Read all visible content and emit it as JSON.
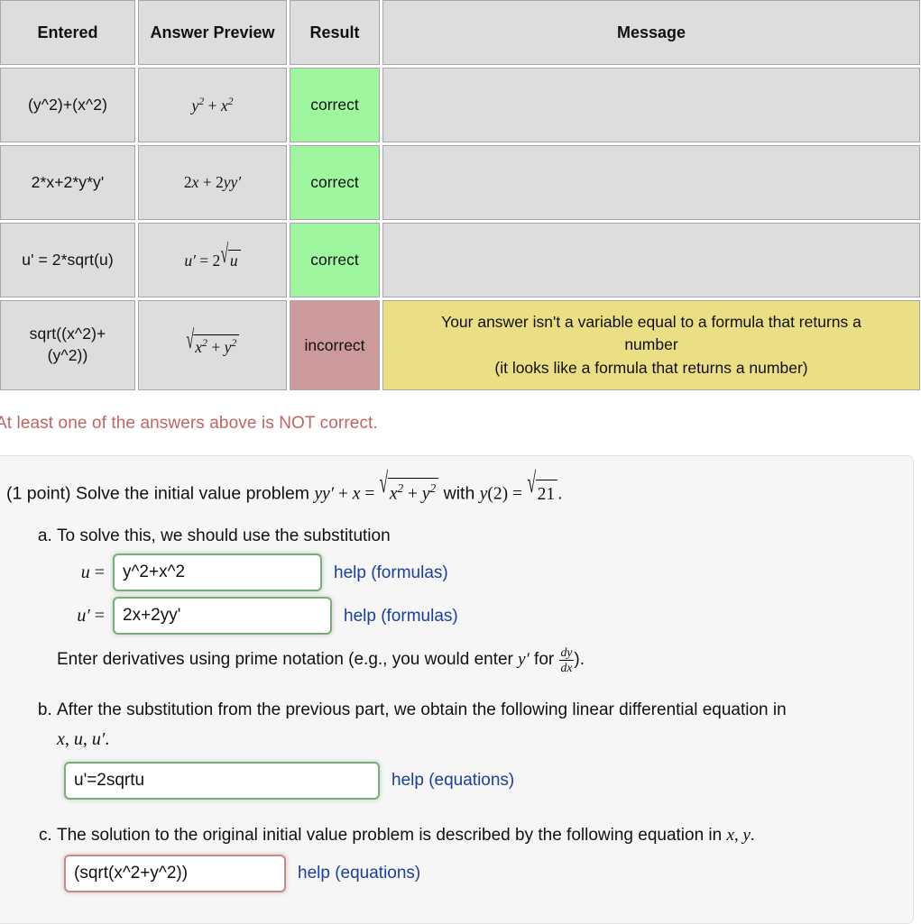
{
  "results_table": {
    "headers": [
      "Entered",
      "Answer Preview",
      "Result",
      "Message"
    ],
    "rows": [
      {
        "entered": "(y^2)+(x^2)",
        "preview_tex": "y^2 + x^2",
        "result": "correct",
        "message": ""
      },
      {
        "entered": "2*x+2*y*y'",
        "preview_tex": "2x + 2yy'",
        "result": "correct",
        "message": ""
      },
      {
        "entered": "u' = 2*sqrt(u)",
        "preview_tex": "u' = 2\\sqrt{u}",
        "result": "correct",
        "message": ""
      },
      {
        "entered": "sqrt((x^2)+(y^2))",
        "preview_tex": "\\sqrt{x^2 + y^2}",
        "result": "incorrect",
        "message_line1": "Your answer isn't a variable equal to a formula that returns a",
        "message_line2": "number",
        "message_line3": "(it looks like a formula that returns a number)"
      }
    ]
  },
  "alert": {
    "text": "At least one of the answers above is NOT correct."
  },
  "problem": {
    "points_label": "(1 point)",
    "statement_lead": "Solve the initial value problem",
    "statement_with": "with",
    "statement_period": ".",
    "parts": {
      "a": {
        "prompt": "To solve this, we should use the substitution",
        "u_label": "u =",
        "u_value": "y^2+x^2",
        "u_help": "help (formulas)",
        "uprime_label": "u' =",
        "uprime_value": "2x+2yy'",
        "uprime_help": "help (formulas)",
        "note_pre": "Enter derivatives using prime notation (e.g., you would enter",
        "note_mid": "for",
        "note_post": ")."
      },
      "b": {
        "prompt": "After the substitution from the previous part, we obtain the following linear differential equation in",
        "vars": "x, u, u'.",
        "value": "u'=2sqrtu",
        "help": "help (equations)"
      },
      "c": {
        "prompt_pre": "The solution to the original initial value problem is described by the following equation in",
        "prompt_vars": "x, y.",
        "value": "(sqrt(x^2+y^2))",
        "help": "help (equations)"
      }
    }
  },
  "colors": {
    "correct_bg": "#9ef79e",
    "incorrect_bg": "#cc9a9a",
    "message_warn_bg": "#eadf85",
    "cell_bg": "#dddddd",
    "result_text": "#1b1f8a",
    "alert_text": "#c06464",
    "link": "#1b3f9e",
    "panel_bg": "#f6f6f6",
    "input_ok_border": "#7aab78",
    "input_bad_border": "#c58b8b"
  }
}
